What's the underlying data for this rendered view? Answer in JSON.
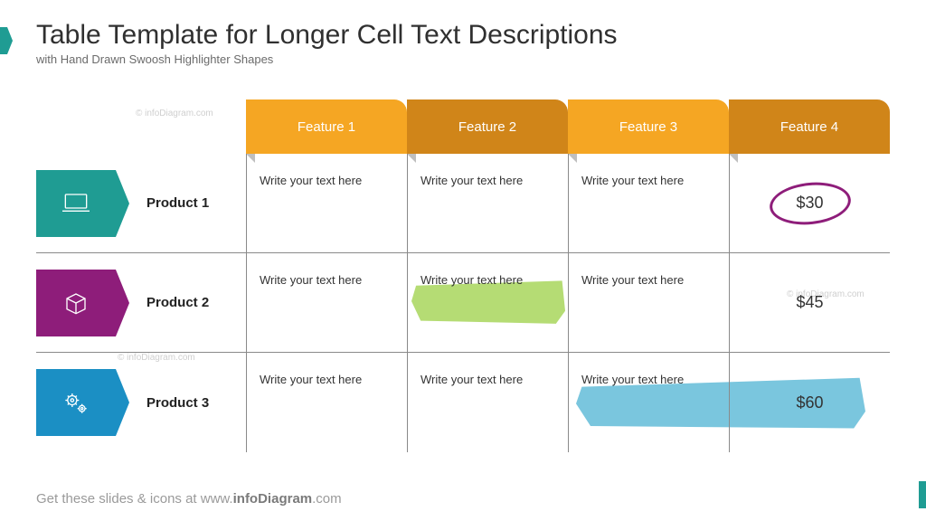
{
  "header": {
    "title": "Table Template for Longer Cell Text Descriptions",
    "subtitle": "with Hand Drawn Swoosh Highlighter Shapes"
  },
  "columns": [
    "Feature 1",
    "Feature 2",
    "Feature 3",
    "Feature 4"
  ],
  "column_styles": [
    "orange",
    "dorange",
    "orange",
    "dorange"
  ],
  "rows": [
    {
      "icon": "laptop-icon",
      "icon_color": "teal",
      "label": "Product 1",
      "cells": [
        "Write your text here",
        "Write your text here",
        "Write your text here",
        "$30"
      ],
      "highlight": {
        "type": "circle",
        "col": 3
      }
    },
    {
      "icon": "box-icon",
      "icon_color": "purple",
      "label": "Product 2",
      "cells": [
        "Write your text here",
        "Write your text here",
        "Write your text here",
        "$45"
      ],
      "highlight": {
        "type": "swoosh-green",
        "col": 1
      }
    },
    {
      "icon": "gears-icon",
      "icon_color": "blue",
      "label": "Product 3",
      "cells": [
        "Write your text here",
        "Write your text here",
        "Write your text here",
        "$60"
      ],
      "highlight": {
        "type": "swoosh-blue",
        "col": 2
      }
    }
  ],
  "footer": {
    "prefix": "Get these slides & icons at www.",
    "bold": "infoDiagram",
    "suffix": ".com"
  },
  "watermark": "© infoDiagram.com",
  "colors": {
    "teal": "#1f9c93",
    "purple": "#8e1d7a",
    "blue": "#1b8fc4",
    "orange": "#f5a623",
    "dorange": "#d08519",
    "circle": "#8e1d7a",
    "swoosh_green": "#a9d65c",
    "swoosh_blue": "#63bcd9"
  }
}
